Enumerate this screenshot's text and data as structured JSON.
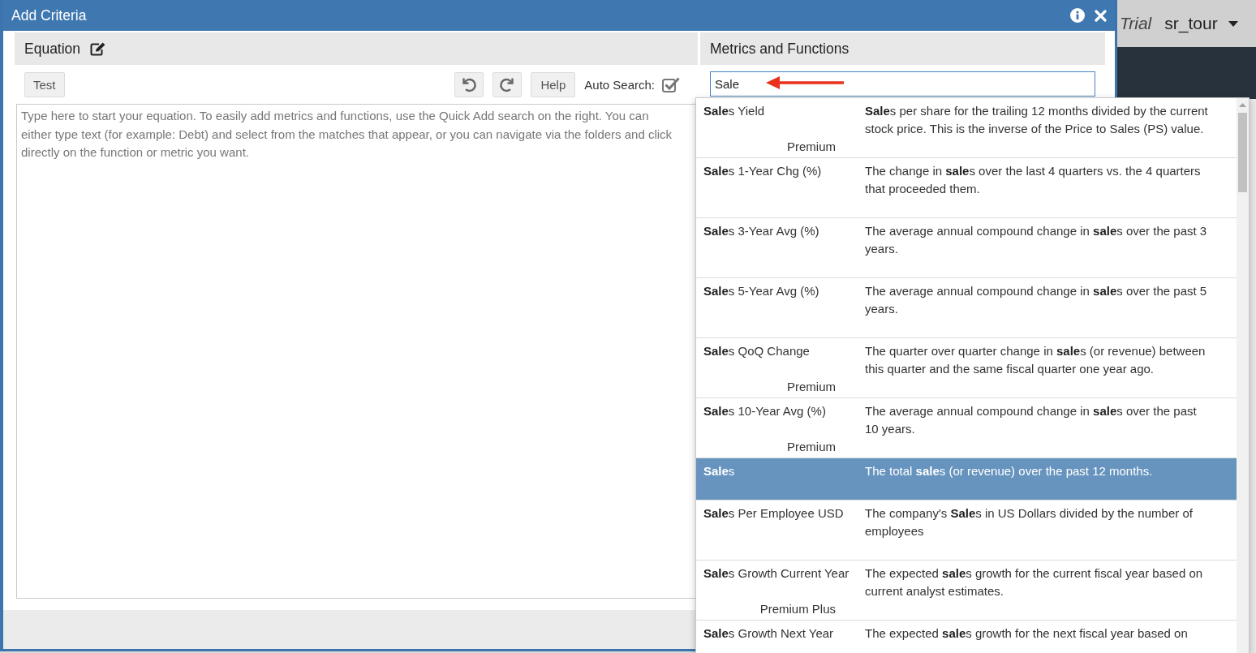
{
  "dialog": {
    "title": "Add Criteria"
  },
  "equation_panel": {
    "title": "Equation",
    "test_button": "Test",
    "help_button": "Help",
    "auto_search": {
      "label": "Auto Search:",
      "checked": true
    },
    "editor": {
      "placeholder": "Type here to start your equation. To easily add metrics and functions, use the Quick Add search on the right. You can either type text (for example: Debt) and select from the matches that appear, or you can navigate via the folders and click directly on the function or metric you want."
    }
  },
  "metrics_panel": {
    "title": "Metrics and Functions",
    "search": {
      "value": "Sale"
    },
    "results": [
      {
        "name": "**Sale**s Yield",
        "description": "**Sale**s per share for the trailing 12 months divided by the current stock price. This is the inverse of the Price to Sales (PS) value.",
        "tier": "Premium",
        "selected": false
      },
      {
        "name": "**Sale**s 1-Year Chg (%)",
        "description": "The change in **sale**s over the last 4 quarters vs. the 4 quarters that proceeded them.",
        "selected": false
      },
      {
        "name": "**Sale**s 3-Year Avg (%)",
        "description": "The average annual compound change in **sale**s over the past 3 years.",
        "selected": false
      },
      {
        "name": "**Sale**s 5-Year Avg (%)",
        "description": "The average annual compound change in **sale**s over the past 5 years.",
        "selected": false
      },
      {
        "name": "**Sale**s QoQ Change",
        "description": "The quarter over quarter change in **sale**s (or revenue) between this quarter and the same fiscal quarter one year ago.",
        "tier": "Premium",
        "selected": false
      },
      {
        "name": "**Sale**s 10-Year Avg (%)",
        "description": "The average annual compound change in **sale**s over the past 10 years.",
        "tier": "Premium",
        "selected": false
      },
      {
        "name": "**Sale**s",
        "description": "The total **sale**s (or revenue) over the past 12 months.",
        "selected": true
      },
      {
        "name": "**Sale**s Per Employee USD",
        "description": "The company's **Sale**s in US Dollars divided by the number of employees",
        "selected": false
      },
      {
        "name": "**Sale**s Growth Current Year",
        "description": "The expected **sale**s growth for the current fiscal year based on current analyst estimates.",
        "tier": "Premium Plus",
        "selected": false
      },
      {
        "name": "**Sale**s Growth Next Year",
        "description": "The expected **sale**s growth for the next fiscal year based on",
        "selected": false
      }
    ]
  },
  "background_page": {
    "trial_label": "Trial",
    "user_menu": "sr_tour"
  }
}
